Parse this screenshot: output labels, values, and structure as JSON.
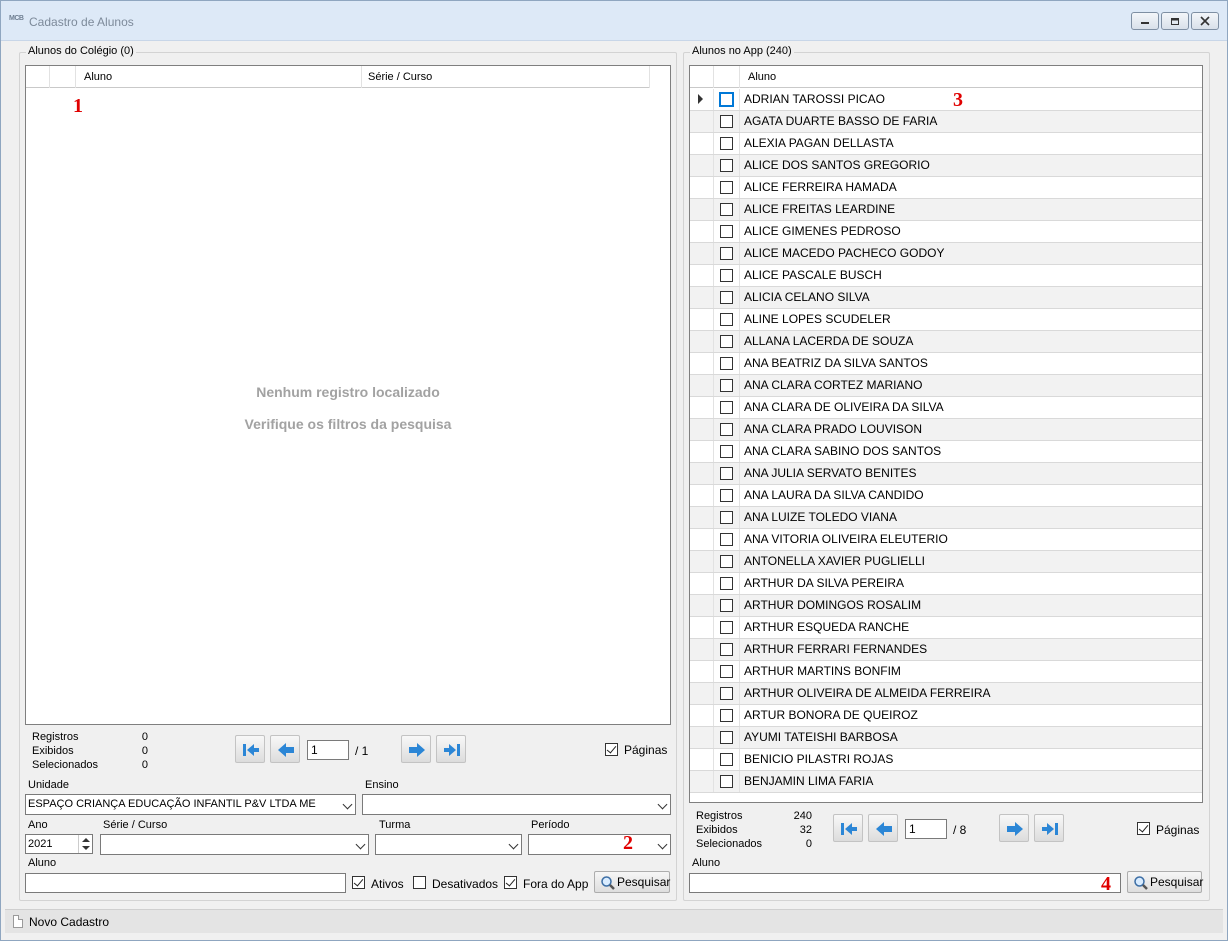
{
  "window": {
    "title": "Cadastro de Alunos",
    "app_icon_text": "MCB"
  },
  "left_panel": {
    "group_title": "Alunos do Colégio (0)",
    "headers": [
      "Aluno",
      "Série / Curso"
    ],
    "empty_line1": "Nenhum registro localizado",
    "empty_line2": "Verifique os filtros da pesquisa",
    "stats": {
      "registros_label": "Registros",
      "registros": "0",
      "exibidos_label": "Exibidos",
      "exibidos": "0",
      "selecionados_label": "Selecionados",
      "selecionados": "0"
    },
    "page_value": "1",
    "page_total": "/ 1",
    "paginas_label": "Páginas",
    "paginas_checked": true
  },
  "filters": {
    "unidade_label": "Unidade",
    "unidade_value": "ESPAÇO CRIANÇA EDUCAÇÃO INFANTIL P&V LTDA ME",
    "ensino_label": "Ensino",
    "ensino_value": "",
    "ano_label": "Ano",
    "ano_value": "2021",
    "serie_label": "Série / Curso",
    "turma_label": "Turma",
    "periodo_label": "Período",
    "aluno_label": "Aluno",
    "ativos_label": "Ativos",
    "ativos_checked": true,
    "desativados_label": "Desativados",
    "desativados_checked": false,
    "fora_label": "Fora do App",
    "fora_checked": true,
    "search_label": "Pesquisar"
  },
  "right_panel": {
    "group_title": "Alunos no App (240)",
    "header": "Aluno",
    "students": [
      "ADRIAN TAROSSI PICAO",
      "AGATA DUARTE BASSO DE FARIA",
      "ALEXIA PAGAN DELLASTA",
      "ALICE DOS SANTOS GREGORIO",
      "ALICE FERREIRA HAMADA",
      "ALICE FREITAS LEARDINE",
      "ALICE GIMENES PEDROSO",
      "ALICE MACEDO PACHECO GODOY",
      "ALICE PASCALE BUSCH",
      "ALICIA CELANO SILVA",
      "ALINE LOPES SCUDELER",
      "ALLANA LACERDA DE SOUZA",
      "ANA BEATRIZ DA SILVA SANTOS",
      "ANA CLARA CORTEZ MARIANO",
      "ANA CLARA DE OLIVEIRA DA SILVA",
      "ANA CLARA PRADO LOUVISON",
      "ANA CLARA SABINO DOS SANTOS",
      "ANA JULIA SERVATO BENITES",
      "ANA LAURA DA SILVA CANDIDO",
      "ANA LUIZE TOLEDO VIANA",
      "ANA VITORIA OLIVEIRA ELEUTERIO",
      "ANTONELLA XAVIER PUGLIELLI",
      "ARTHUR DA SILVA PEREIRA",
      "ARTHUR DOMINGOS ROSALIM",
      "ARTHUR ESQUEDA RANCHE",
      "ARTHUR FERRARI FERNANDES",
      "ARTHUR MARTINS BONFIM",
      "ARTHUR OLIVEIRA DE ALMEIDA FERREIRA",
      "ARTUR BONORA DE QUEIROZ",
      "AYUMI TATEISHI BARBOSA",
      "BENICIO PILASTRI ROJAS",
      "BENJAMIN LIMA FARIA"
    ],
    "stats": {
      "registros_label": "Registros",
      "registros": "240",
      "exibidos_label": "Exibidos",
      "exibidos": "32",
      "selecionados_label": "Selecionados",
      "selecionados": "0"
    },
    "page_value": "1",
    "page_total": "/ 8",
    "paginas_label": "Páginas",
    "paginas_checked": true,
    "aluno_label": "Aluno",
    "search_label": "Pesquisar"
  },
  "annotations": [
    "1",
    "2",
    "3",
    "4"
  ],
  "annotation_color": "#e00000",
  "statusbar": {
    "new_label": "Novo Cadastro"
  }
}
